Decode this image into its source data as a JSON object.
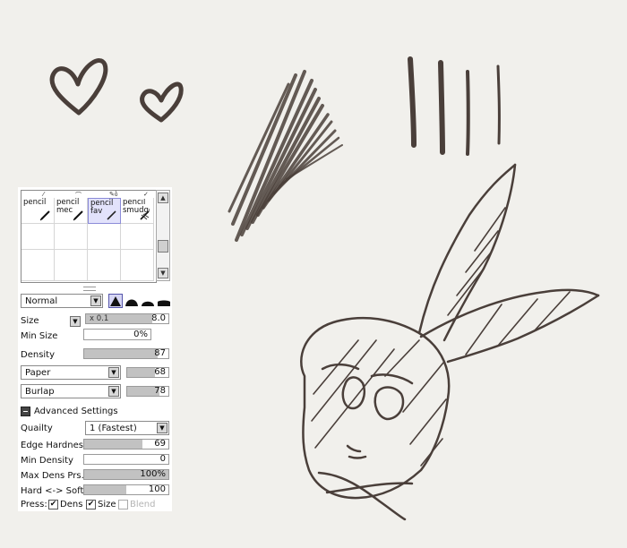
{
  "brushes": [
    {
      "name": "pencil",
      "selected": false
    },
    {
      "name": "pencil mec",
      "selected": false
    },
    {
      "name": "pencil fav",
      "selected": true
    },
    {
      "name": "pencil smudge",
      "selected": false
    }
  ],
  "blend": {
    "mode": "Normal",
    "shape_selected": "sharp-triangle"
  },
  "size": {
    "label": "Size",
    "multiplier": "x 0.1",
    "value": "8.0",
    "fill": 0.8
  },
  "min_size": {
    "label": "Min Size",
    "value": "0%"
  },
  "density": {
    "label": "Density",
    "value": "87",
    "fill": 0.87
  },
  "texture1": {
    "name": "Paper",
    "value": "68",
    "fill": 0.68
  },
  "texture2": {
    "name": "Burlap",
    "value": "78",
    "fill": 0.78
  },
  "advanced": {
    "title": "Advanced Settings",
    "quality": {
      "label": "Quailty",
      "value": "1 (Fastest)"
    },
    "edge_hardness": {
      "label": "Edge Hardness",
      "value": "69",
      "fill": 0.69
    },
    "min_density": {
      "label": "Min Density",
      "value": "0",
      "fill": 0
    },
    "max_dens_prs": {
      "label": "Max Dens Prs.",
      "value": "100%",
      "fill": 1.0
    },
    "hard_soft": {
      "label": "Hard <-> Soft",
      "value": "100",
      "fill": 0.5
    }
  },
  "press": {
    "label": "Press:",
    "dens": {
      "label": "Dens",
      "checked": true
    },
    "size": {
      "label": "Size",
      "checked": true
    },
    "blend": {
      "label": "Blend",
      "checked": false
    }
  },
  "colors": {
    "canvas": "#f1f0ec",
    "ink": "#4a3f3a",
    "selection": "#e2e2fb"
  }
}
